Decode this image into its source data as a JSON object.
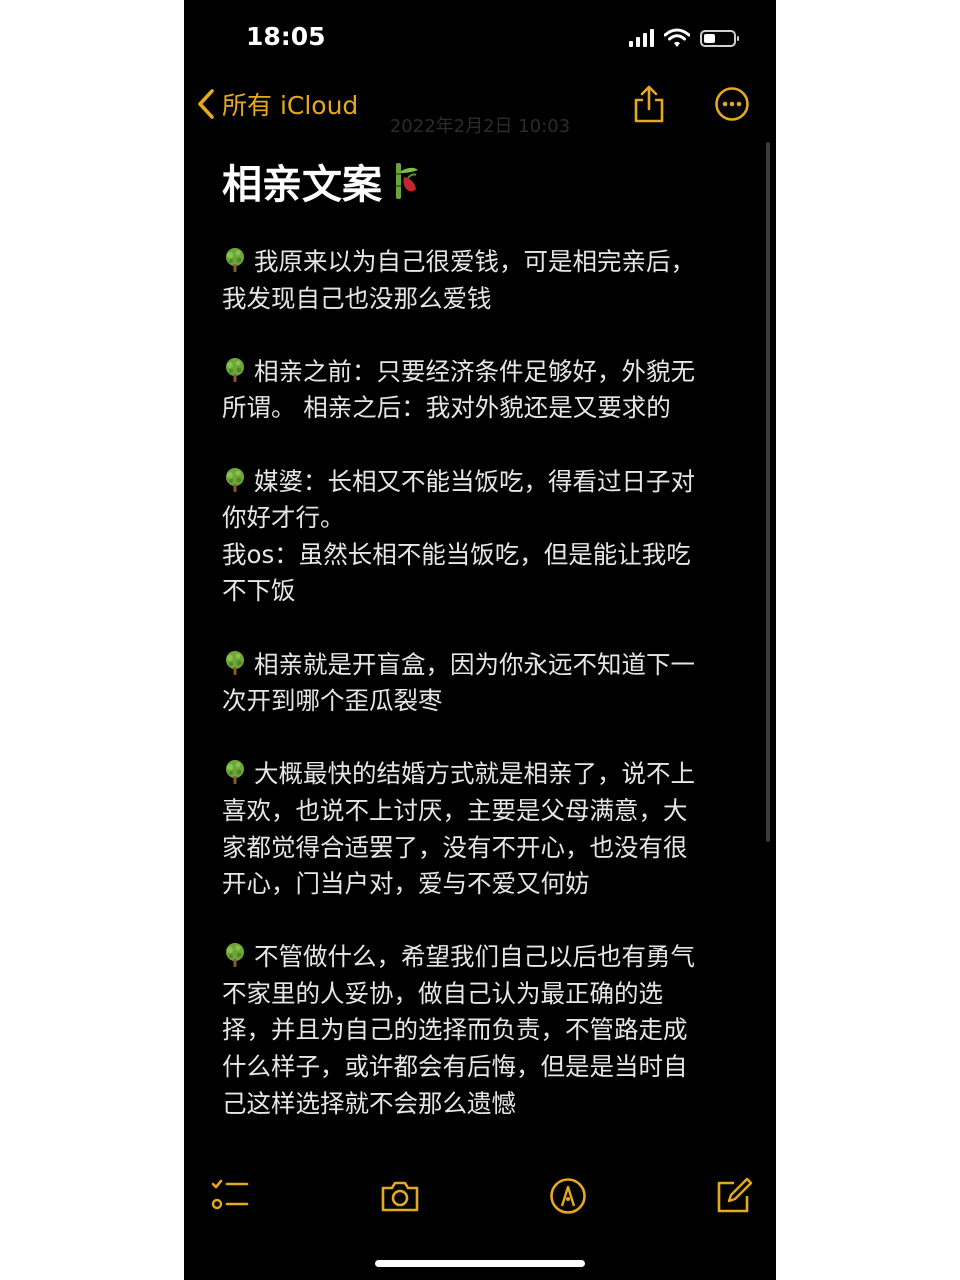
{
  "status_bar": {
    "time": "18:05"
  },
  "nav": {
    "back_label": "所有 iCloud",
    "date": "2022年2月2日 10:03"
  },
  "note": {
    "title": "相亲文案",
    "paragraphs": [
      {
        "lines": [
          "我原来以为自己很爱钱，可是相完亲后，",
          "我发现自己也没那么爱钱"
        ]
      },
      {
        "lines": [
          "相亲之前：只要经济条件足够好，外貌无",
          "所谓。 相亲之后：我对外貌还是又要求的"
        ]
      },
      {
        "lines": [
          "媒婆：长相又不能当饭吃，得看过日子对",
          "你好才行。",
          "我os：虽然长相不能当饭吃，但是能让我吃",
          "不下饭"
        ]
      },
      {
        "lines": [
          "相亲就是开盲盒，因为你永远不知道下一",
          "次开到哪个歪瓜裂枣"
        ]
      },
      {
        "lines": [
          "大概最快的结婚方式就是相亲了，说不上",
          "喜欢，也说不上讨厌，主要是父母满意，大",
          "家都觉得合适罢了，没有不开心，也没有很",
          "开心，门当户对，爱与不爱又何妨"
        ]
      },
      {
        "lines": [
          "不管做什么，希望我们自己以后也有勇气",
          "不家里的人妥协，做自己认为最正确的选",
          "择，并且为自己的选择而负责，不管路走成",
          "什么样子，或许都会有后悔，但是是当时自",
          "己这样选择就不会那么遗憾"
        ]
      }
    ]
  },
  "icons": {
    "title_emoji": "bamboo-icon",
    "bullet": "tree-icon",
    "toolbar": [
      "checklist-icon",
      "camera-icon",
      "markup-pen-icon",
      "compose-icon"
    ]
  },
  "colors": {
    "accent": "#e5a91e",
    "background": "#000000",
    "text": "#e6e6e6",
    "bullet_green": "#6fa63a"
  }
}
